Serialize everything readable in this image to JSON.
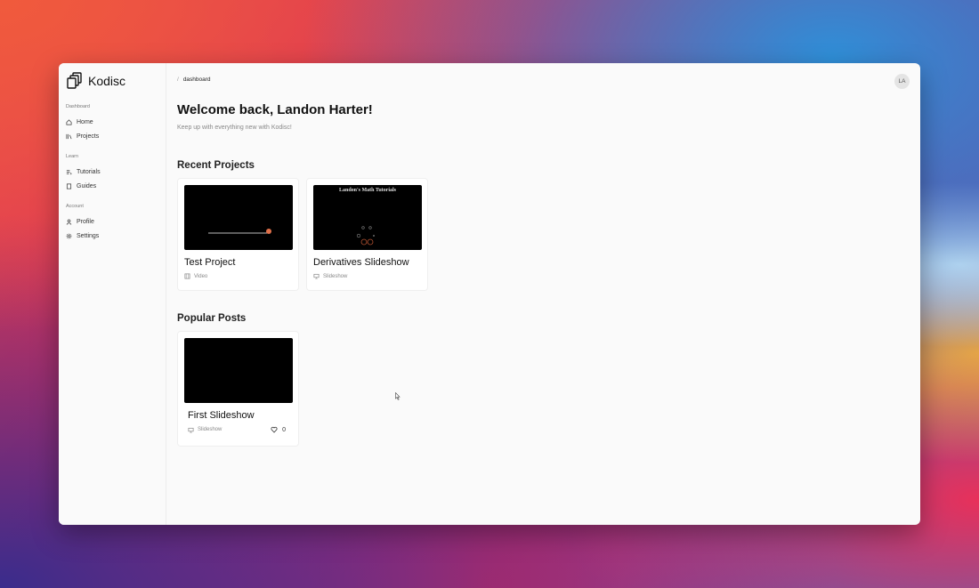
{
  "app": {
    "name": "Kodisc"
  },
  "sidebar": {
    "sections": [
      {
        "heading": "Dashboard",
        "items": [
          {
            "label": "Home",
            "icon": "home-icon"
          },
          {
            "label": "Projects",
            "icon": "projects-icon"
          }
        ]
      },
      {
        "heading": "Learn",
        "items": [
          {
            "label": "Tutorials",
            "icon": "tutorials-icon"
          },
          {
            "label": "Guides",
            "icon": "book-icon"
          }
        ]
      },
      {
        "heading": "Account",
        "items": [
          {
            "label": "Profile",
            "icon": "user-icon"
          },
          {
            "label": "Settings",
            "icon": "gear-icon"
          }
        ]
      }
    ]
  },
  "breadcrumb": {
    "separator": "/",
    "current": "dashboard"
  },
  "user": {
    "initials": "LA"
  },
  "header": {
    "title": "Welcome back, Landon Harter!",
    "subtitle": "Keep up with everything new with Kodisc!"
  },
  "recent": {
    "title": "Recent Projects",
    "cards": [
      {
        "title": "Test Project",
        "type": "Video",
        "type_icon": "film-icon"
      },
      {
        "title": "Derivatives Slideshow",
        "type": "Slideshow",
        "type_icon": "monitor-icon",
        "thumb_text": "Landon's Math Tutorials"
      }
    ]
  },
  "popular": {
    "title": "Popular Posts",
    "cards": [
      {
        "title": "First Slideshow",
        "type": "Slideshow",
        "type_icon": "monitor-icon",
        "likes": "0"
      }
    ]
  },
  "colors": {
    "accent_dot": "#e0704a",
    "thumb_bg": "#000000"
  }
}
